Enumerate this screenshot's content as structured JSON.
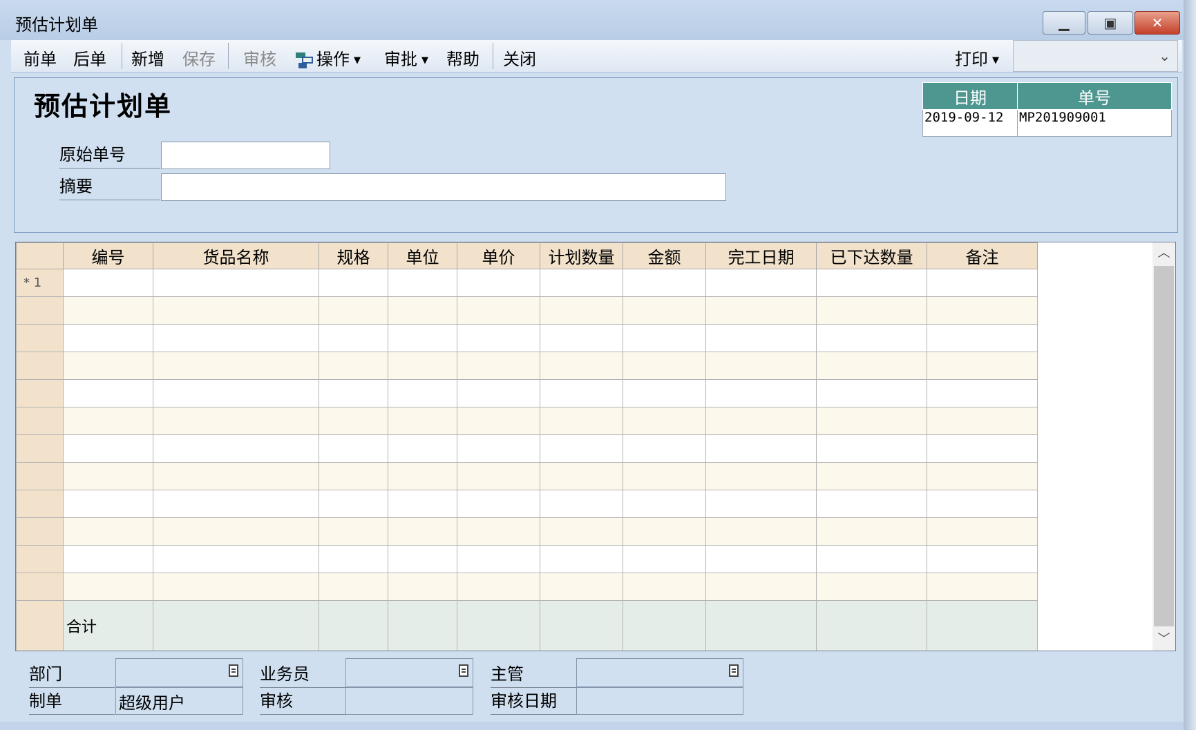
{
  "window": {
    "title": "预估计划单"
  },
  "toolbar": {
    "prev": "前单",
    "next": "后单",
    "new": "新增",
    "save": "保存",
    "audit": "审核",
    "operate": "操作",
    "approve": "审批",
    "help": "帮助",
    "close": "关闭",
    "print": "打印",
    "print_combo_value": ""
  },
  "form": {
    "heading": "预估计划单",
    "orig_no_label": "原始单号",
    "orig_no_value": "",
    "summary_label": "摘要",
    "summary_value": "",
    "date_label": "日期",
    "date_value": "2019-09-12",
    "number_label": "单号",
    "number_value": "MP201909001"
  },
  "grid": {
    "columns": [
      "编号",
      "货品名称",
      "规格",
      "单位",
      "单价",
      "计划数量",
      "金额",
      "完工日期",
      "已下达数量",
      "备注"
    ],
    "first_row_marker": "* 1",
    "total_label": "合计"
  },
  "footer": {
    "dept_label": "部门",
    "dept_value": "",
    "salesman_label": "业务员",
    "salesman_value": "",
    "manager_label": "主管",
    "manager_value": "",
    "creator_label": "制单",
    "creator_value": "超级用户",
    "auditor_label": "审核",
    "auditor_value": "",
    "audit_date_label": "审核日期",
    "audit_date_value": ""
  },
  "colors": {
    "header_teal": "#4e9690",
    "grid_header": "#f2e2cb",
    "window_bg": "#cfdff0"
  }
}
